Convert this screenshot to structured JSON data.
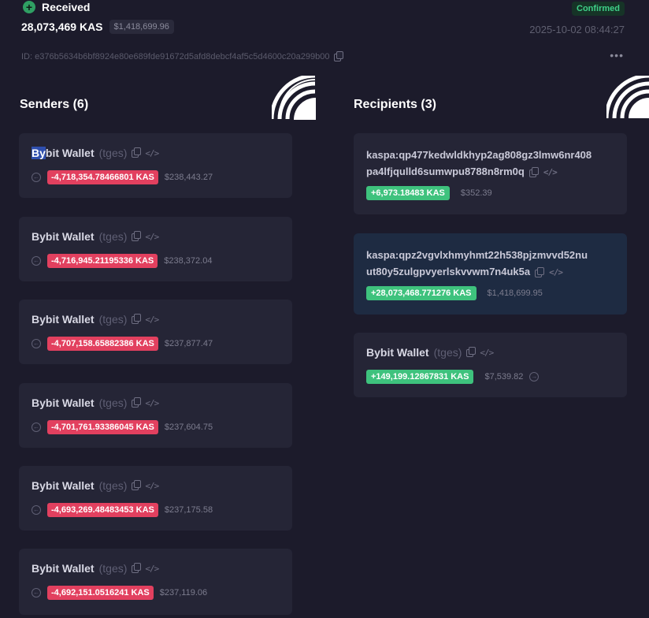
{
  "header": {
    "status": "Received",
    "amount": "28,073,469 KAS",
    "amount_usd": "$1,418,699.96",
    "confirmation": "Confirmed",
    "timestamp": "2025-10-02 08:44:27",
    "tx_id": "ID: e376b5634b6bf8924e80e689fde91672d5afd8debcf4af5c5d4600c20a299b00",
    "more": "•••"
  },
  "senders": {
    "title": "Senders (6)",
    "items": [
      {
        "name_sel": "By",
        "name_rest": "bit Wallet",
        "tag": "(tges)",
        "amount": "-4,718,354.78466801 KAS",
        "usd": "$238,443.27"
      },
      {
        "name": "Bybit Wallet",
        "tag": "(tges)",
        "amount": "-4,716,945.21195336 KAS",
        "usd": "$238,372.04"
      },
      {
        "name": "Bybit Wallet",
        "tag": "(tges)",
        "amount": "-4,707,158.65882386 KAS",
        "usd": "$237,877.47"
      },
      {
        "name": "Bybit Wallet",
        "tag": "(tges)",
        "amount": "-4,701,761.93386045 KAS",
        "usd": "$237,604.75"
      },
      {
        "name": "Bybit Wallet",
        "tag": "(tges)",
        "amount": "-4,693,269.48483453 KAS",
        "usd": "$237,175.58"
      },
      {
        "name": "Bybit Wallet",
        "tag": "(tges)",
        "amount": "-4,692,151.0516241 KAS",
        "usd": "$237,119.06"
      }
    ]
  },
  "recipients": {
    "title": "Recipients (3)",
    "items": [
      {
        "addr_line1": "kaspa:qp477kedwldkhyp2ag808gz3lmw6nr408",
        "addr_line2": "pa4lfjqulld6sumwpu8788n8rm0q",
        "amount": "+6,973.18483 KAS",
        "usd": "$352.39"
      },
      {
        "addr_line1": "kaspa:qpz2vgvlxhmyhmt22h538pjzmvvd52nu",
        "addr_line2": "ut80y5zulgpvyerlskvvwm7n4uk5a",
        "amount": "+28,073,468.771276 KAS",
        "usd": "$1,418,699.95"
      },
      {
        "name": "Bybit Wallet",
        "tag": "(tges)",
        "amount": "+149,199.12867831 KAS",
        "usd": "$7,539.82"
      }
    ]
  },
  "icons": [
    "plus-circle-icon",
    "copy-icon",
    "code-icon",
    "arrow-left-circle-icon",
    "arrow-right-circle-icon",
    "more-icon"
  ],
  "colors": {
    "negative": "#e2405f",
    "positive": "#3ec27d",
    "confirmed": "#3fd088",
    "background": "#1c1b2b",
    "card": "#252536"
  }
}
